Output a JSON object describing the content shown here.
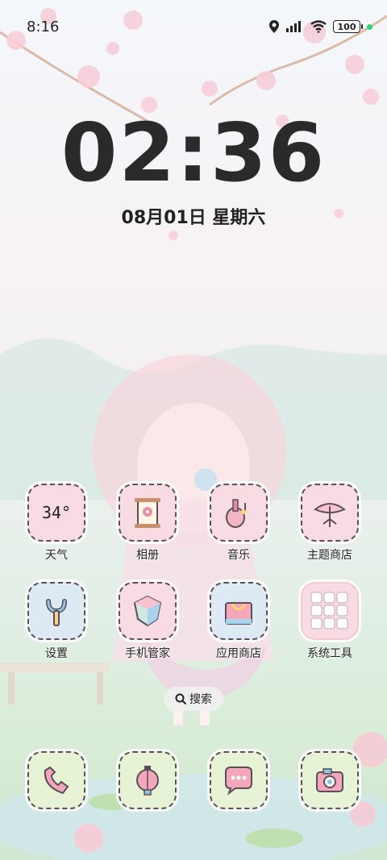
{
  "status_bar": {
    "time": "8:16",
    "battery": "100",
    "icons": [
      "location-icon",
      "signal-icon",
      "wifi-icon",
      "battery-icon"
    ]
  },
  "lockscreen": {
    "clock": "02:36",
    "date": "08月01日 星期六"
  },
  "apps_row1": [
    {
      "label": "天气",
      "icon": "weather-icon",
      "text": "34°"
    },
    {
      "label": "相册",
      "icon": "gallery-icon"
    },
    {
      "label": "音乐",
      "icon": "music-icon"
    },
    {
      "label": "主题商店",
      "icon": "theme-store-icon"
    }
  ],
  "apps_row2": [
    {
      "label": "设置",
      "icon": "settings-icon"
    },
    {
      "label": "手机管家",
      "icon": "phone-manager-icon"
    },
    {
      "label": "应用商店",
      "icon": "app-store-icon"
    },
    {
      "label": "系统工具",
      "icon": "system-tools-folder"
    }
  ],
  "search": {
    "label": "搜索"
  },
  "dock": [
    {
      "icon": "phone-icon"
    },
    {
      "icon": "browser-lantern-icon"
    },
    {
      "icon": "messages-icon"
    },
    {
      "icon": "camera-icon"
    }
  ],
  "colors": {
    "pink_tile": "#f8dbe3",
    "blue_tile": "#dde9f3",
    "green_tile": "#e7f3d5",
    "accent_green": "#2fd27a"
  }
}
